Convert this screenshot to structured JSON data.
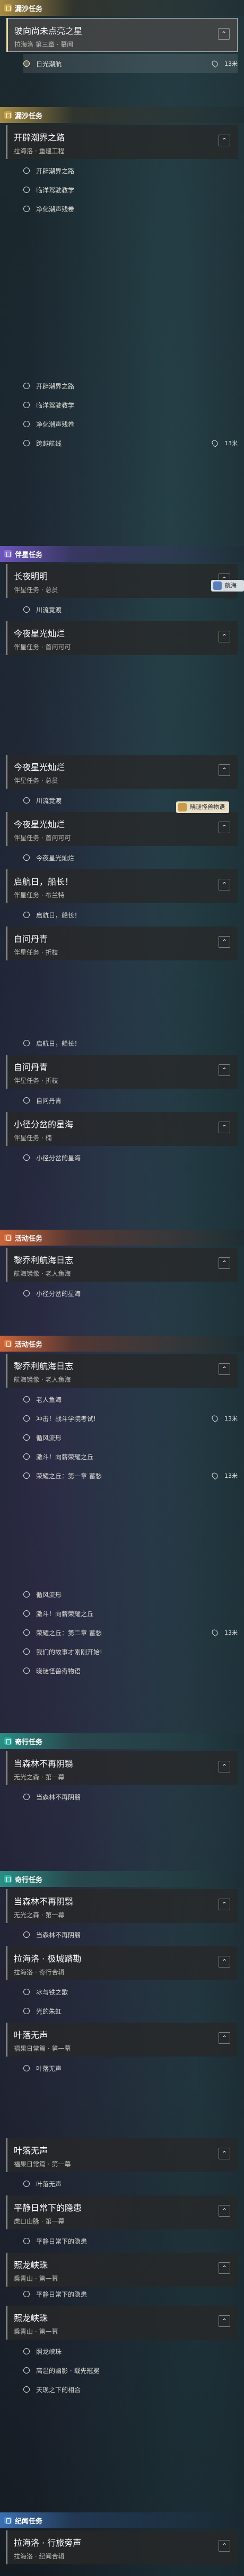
{
  "sections": [
    {
      "id": "s1",
      "header": "漏沙任务",
      "color": "gold",
      "items": [
        {
          "type": "card",
          "title": "驶向尚未点亮之星",
          "sub": "拉海洛 第三章 · 慕闻",
          "selected": true
        },
        {
          "type": "obj",
          "label": "日光潮航",
          "dist": "13米",
          "active": true
        }
      ]
    },
    {
      "id": "s2",
      "header": "漏沙任务",
      "color": "gold",
      "items": [
        {
          "type": "card",
          "title": "开辟潮界之路",
          "sub": "拉海洛 · 重建工程",
          "selected": false
        },
        {
          "type": "obj",
          "label": "开辟潮界之路"
        },
        {
          "type": "obj",
          "label": "临洋驾驶教学"
        },
        {
          "type": "obj",
          "label": "净化潮声残卷"
        }
      ]
    },
    {
      "id": "s3",
      "header": "",
      "color": "none",
      "items": [
        {
          "type": "obj",
          "label": "开辟潮界之路"
        },
        {
          "type": "obj",
          "label": "临洋驾驶教学"
        },
        {
          "type": "obj",
          "label": "净化潮声残卷"
        },
        {
          "type": "obj",
          "label": "跨越航线",
          "dist": "13米"
        }
      ]
    },
    {
      "id": "s4",
      "header": "伴星任务",
      "color": "purple",
      "items": [
        {
          "type": "card",
          "title": "长夜明明",
          "sub": "伴星任务 · 总员"
        },
        {
          "type": "obj",
          "label": "川流竟渡"
        },
        {
          "type": "card",
          "title": "今夜星光灿烂",
          "sub": "伴星任务 · 首问可可"
        }
      ]
    },
    {
      "id": "s5",
      "header": "",
      "color": "none",
      "items": [
        {
          "type": "card",
          "title": "今夜星光灿烂",
          "sub": "伴星任务 · 总员"
        },
        {
          "type": "obj",
          "label": "川流竟渡"
        },
        {
          "type": "card",
          "title": "今夜星光灿烂",
          "sub": "伴星任务 · 首问可可"
        },
        {
          "type": "obj",
          "label": "今夜星光灿烂"
        },
        {
          "type": "card",
          "title": "启航日，船长！",
          "sub": "伴星任务 · 布兰特"
        },
        {
          "type": "obj",
          "label": "启航日，船长！"
        },
        {
          "type": "card",
          "title": "自问丹青",
          "sub": "伴星任务 · 折枝"
        }
      ]
    },
    {
      "id": "s6",
      "header": "",
      "color": "none",
      "items": [
        {
          "type": "obj",
          "label": "启航日，船长！"
        },
        {
          "type": "card",
          "title": "自问丹青",
          "sub": "伴星任务 · 折枝"
        },
        {
          "type": "obj",
          "label": "自问丹青"
        },
        {
          "type": "card",
          "title": "小径分岔的星海",
          "sub": "伴星任务 · 楠"
        },
        {
          "type": "obj",
          "label": "小径分岔的星海"
        }
      ]
    },
    {
      "id": "s7",
      "header": "活动任务",
      "color": "orange",
      "items": [
        {
          "type": "card",
          "title": "黎乔利航海日志",
          "sub": "航海镜像 · 老人鱼海"
        },
        {
          "type": "obj",
          "label": "小径分岔的星海"
        }
      ]
    },
    {
      "id": "s8",
      "header": "活动任务",
      "color": "orange",
      "items": [
        {
          "type": "card",
          "title": "黎乔利航海日志",
          "sub": "航海镜像 · 老人鱼海"
        },
        {
          "type": "obj",
          "label": "老人鱼海"
        },
        {
          "type": "obj",
          "label": "冲击！战斗学院考试!",
          "dist": "13米"
        },
        {
          "type": "obj",
          "label": "循风流形"
        },
        {
          "type": "obj",
          "label": "激斗！向薪荣耀之丘"
        },
        {
          "type": "obj",
          "label": "荣耀之丘：第一章 蓄愁",
          "dist": "13米"
        }
      ]
    },
    {
      "id": "s9",
      "header": "",
      "color": "none",
      "items": [
        {
          "type": "obj",
          "label": "循风流形"
        },
        {
          "type": "obj",
          "label": "激斗！向薪荣耀之丘"
        },
        {
          "type": "obj",
          "label": "荣耀之丘：第二章 蓄愁",
          "dist": "13米"
        },
        {
          "type": "obj",
          "label": "我们的故事才刚刚开始!"
        },
        {
          "type": "obj",
          "label": "晓谜怪兽奇物语"
        }
      ]
    },
    {
      "id": "s10",
      "header": "奇行任务",
      "color": "teal",
      "items": [
        {
          "type": "card",
          "title": "当森林不再阴翳",
          "sub": "无光之森 · 第一幕"
        },
        {
          "type": "obj",
          "label": "当森林不再阴翳"
        }
      ]
    },
    {
      "id": "s11",
      "header": "奇行任务",
      "color": "teal",
      "items": [
        {
          "type": "card",
          "title": "当森林不再阴翳",
          "sub": "无光之森 · 第一幕"
        },
        {
          "type": "obj",
          "label": "当森林不再阴翳"
        },
        {
          "type": "card",
          "title": "拉海洛 · 极城踏勘",
          "sub": "拉海洛 · 奇行合辑"
        },
        {
          "type": "obj",
          "label": "冰与铁之歌"
        },
        {
          "type": "obj",
          "label": "光的朱虹"
        },
        {
          "type": "card",
          "title": "叶落无声",
          "sub": "福果日常篇 · 第一幕"
        },
        {
          "type": "obj",
          "label": "叶落无声"
        }
      ]
    },
    {
      "id": "s12",
      "header": "",
      "color": "none",
      "items": [
        {
          "type": "card",
          "title": "叶落无声",
          "sub": "福果日常篇 · 第一幕"
        },
        {
          "type": "obj",
          "label": "叶落无声"
        },
        {
          "type": "card",
          "title": "平静日常下的隐患",
          "sub": "虎口山脉 · 第一幕"
        },
        {
          "type": "obj",
          "label": "平静日常下的隐患"
        },
        {
          "type": "card",
          "title": "照龙峡珠",
          "sub": "乘青山 · 第一幕"
        }
      ]
    },
    {
      "id": "s13",
      "header": "",
      "color": "none",
      "items": [
        {
          "type": "obj",
          "label": "平静日常下的隐患"
        },
        {
          "type": "card",
          "title": "照龙峡珠",
          "sub": "乘青山 · 第一幕"
        },
        {
          "type": "obj",
          "label": "照龙峡珠"
        },
        {
          "type": "obj",
          "label": "高温的幽影 · 载先冠冕"
        },
        {
          "type": "obj",
          "label": "天现之下的相合"
        }
      ]
    },
    {
      "id": "s14",
      "header": "纪闻任务",
      "color": "blue",
      "items": [
        {
          "type": "card",
          "title": "拉海洛 · 行旅旁声",
          "sub": "拉海洛 · 纪闻合辑"
        }
      ]
    }
  ],
  "bubbles": [
    {
      "id": "b1",
      "label": "航海镜像"
    },
    {
      "id": "b2",
      "label": "晓谜怪兽物语"
    }
  ]
}
